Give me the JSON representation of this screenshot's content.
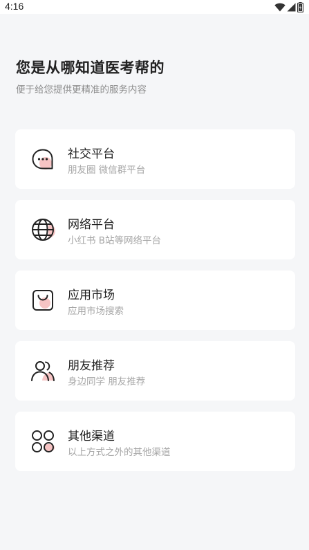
{
  "status_bar": {
    "time": "4:16",
    "icons": [
      "wifi-icon",
      "signal-icon",
      "battery-icon"
    ]
  },
  "header": {
    "title": "您是从哪知道医考帮的",
    "subtitle": "便于给您提供更精准的服务内容"
  },
  "options": [
    {
      "title": "社交平台",
      "desc": "朋友圈 微信群平台",
      "icon": "chat-bubble-icon"
    },
    {
      "title": "网络平台",
      "desc": "小红书 B站等网络平台",
      "icon": "globe-icon"
    },
    {
      "title": "应用市场",
      "desc": "应用市场搜索",
      "icon": "shopping-bag-icon"
    },
    {
      "title": "朋友推荐",
      "desc": "身边同学 朋友推荐",
      "icon": "users-icon"
    },
    {
      "title": "其他渠道",
      "desc": "以上方式之外的其他渠道",
      "icon": "grid-icon"
    }
  ],
  "colors": {
    "background": "#f5f6f8",
    "card": "#ffffff",
    "accent_pink": "#f6c4c4",
    "text_primary": "#222222",
    "text_secondary": "#a6a6a6"
  }
}
